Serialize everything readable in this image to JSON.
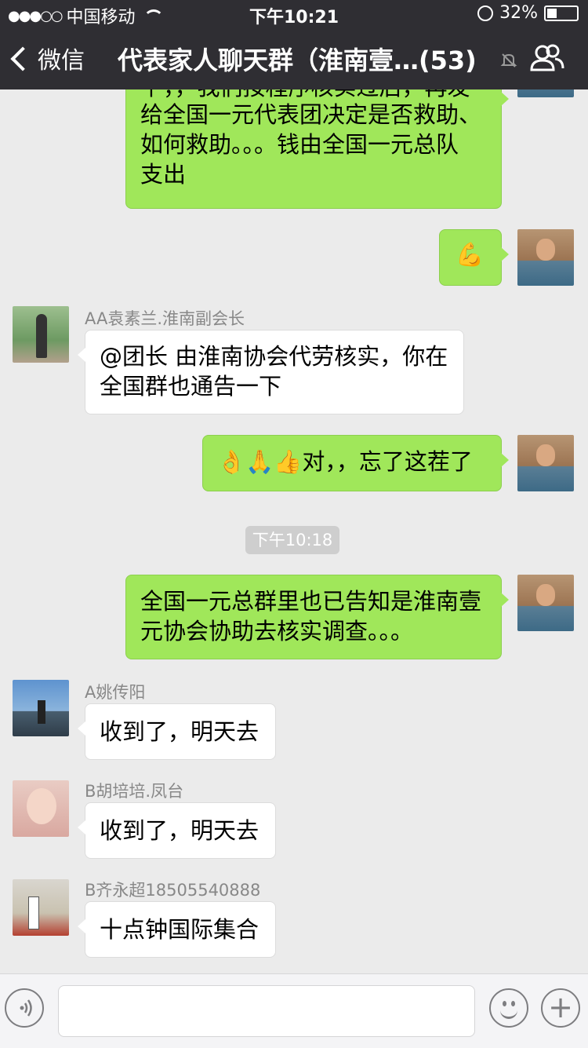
{
  "status_bar": {
    "signal": "●●●○○",
    "carrier": "中国移动",
    "time": "下午10:21",
    "battery": "32%",
    "battery_level": 0.32
  },
  "nav": {
    "back_label": "微信",
    "title": "代表家人聊天群（淮南壹…(53)"
  },
  "messages": [
    {
      "side": "self",
      "lines": [
        "下，，我们按程序核实过后，再发",
        "给全国一元代表团决定是否救助、",
        "如何救助。。。钱由全国一元总队",
        "支出"
      ]
    },
    {
      "side": "self",
      "text": "💪"
    },
    {
      "side": "other",
      "sender": "AA袁素兰.淮南副会长",
      "lines": [
        "@团长 由淮南协会代劳核实，你在",
        "全国群也通告一下"
      ]
    },
    {
      "side": "self",
      "emoji": "👌🙏👍",
      "text": "对，，忘了这茬了"
    },
    {
      "timestamp": "下午10:18"
    },
    {
      "side": "self",
      "lines": [
        "全国一元总群里也已告知是淮南壹",
        "元协会协助去核实调查。。。"
      ]
    },
    {
      "side": "other",
      "sender": "A姚传阳",
      "text": "收到了，明天去"
    },
    {
      "side": "other",
      "sender": "B胡培培.凤台",
      "text": "收到了，明天去"
    },
    {
      "side": "other",
      "sender": "B齐永超18505540888",
      "text": "十点钟国际集合"
    }
  ],
  "colors": {
    "nav_bg": "#2f2e33",
    "chat_bg": "#ebebeb",
    "self_bubble": "#a0e75a",
    "other_bubble": "#ffffff"
  },
  "icons": [
    "back-chevron-icon",
    "mute-icon",
    "members-icon",
    "voice-icon",
    "emoji-icon",
    "plus-icon"
  ]
}
